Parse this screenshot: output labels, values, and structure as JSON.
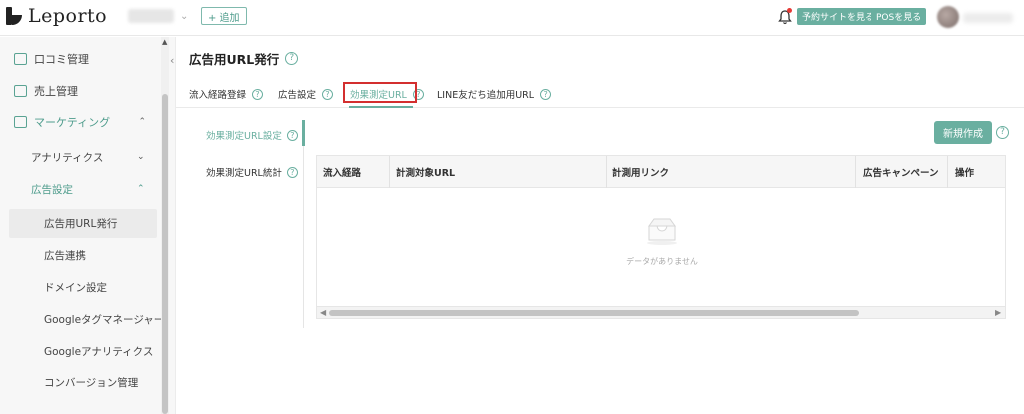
{
  "app": {
    "logo_text": "Leporto"
  },
  "header": {
    "add_label": "+ 追加",
    "reserve_site_label": "予約サイトを見る",
    "pos_label": "POSを見る"
  },
  "sidebar": {
    "items": [
      {
        "label": "口コミ管理"
      },
      {
        "label": "売上管理"
      },
      {
        "label": "マーケティング"
      }
    ],
    "marketing_sub": [
      {
        "label": "アナリティクス"
      },
      {
        "label": "広告設定"
      }
    ],
    "ad_sub": [
      {
        "label": "広告用URL発行"
      },
      {
        "label": "広告連携"
      },
      {
        "label": "ドメイン設定"
      },
      {
        "label": "Googleタグマネージャー"
      },
      {
        "label": "Googleアナリティクス"
      },
      {
        "label": "コンバージョン管理"
      }
    ]
  },
  "main": {
    "title": "広告用URL発行",
    "tabs": [
      {
        "label": "流入経路登録"
      },
      {
        "label": "広告設定"
      },
      {
        "label": "効果測定URL"
      },
      {
        "label": "LINE友だち追加用URL"
      }
    ],
    "subnav": [
      {
        "label": "効果測定URL設定"
      },
      {
        "label": "効果測定URL統計"
      }
    ],
    "new_button": "新規作成",
    "table": {
      "columns": [
        "流入経路",
        "計測対象URL",
        "計測用リンク",
        "広告キャンペーン",
        "操作"
      ],
      "empty_text": "データがありません"
    }
  },
  "colors": {
    "accent": "#6aafa0",
    "highlight": "#d32f2f"
  }
}
